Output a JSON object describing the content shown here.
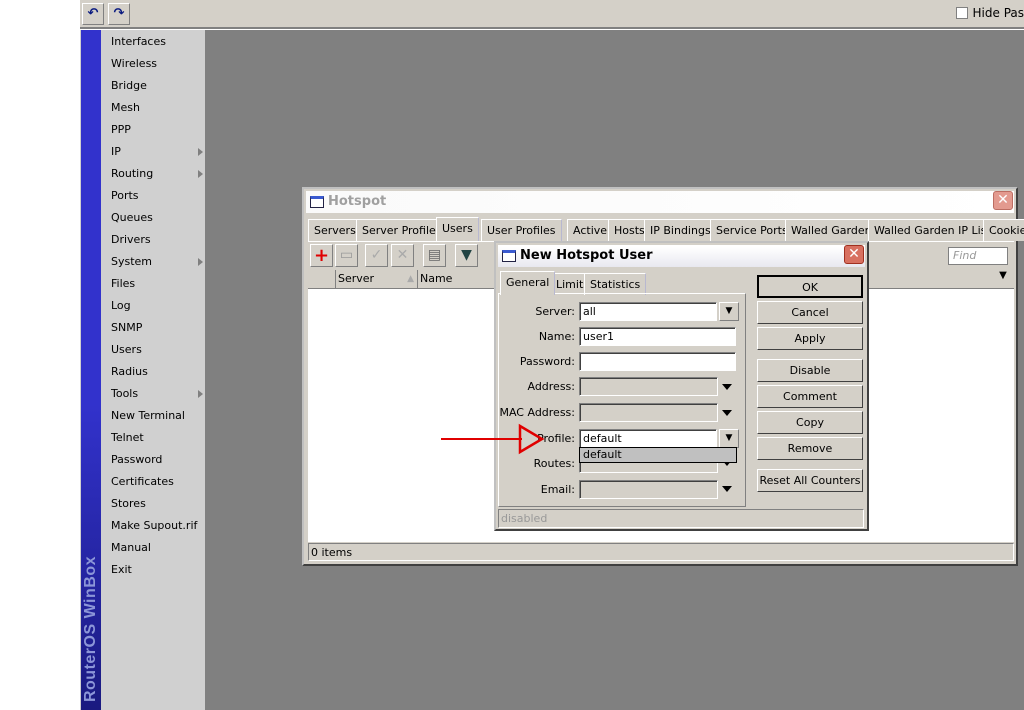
{
  "toolbar": {
    "undo_icon": "undo-icon",
    "redo_icon": "redo-icon",
    "hide_passwords": "Hide Pas"
  },
  "sidebar": {
    "brand": "RouterOS WinBox",
    "items": [
      {
        "label": "Interfaces",
        "sub": false
      },
      {
        "label": "Wireless",
        "sub": false
      },
      {
        "label": "Bridge",
        "sub": false
      },
      {
        "label": "Mesh",
        "sub": false
      },
      {
        "label": "PPP",
        "sub": false
      },
      {
        "label": "IP",
        "sub": true
      },
      {
        "label": "Routing",
        "sub": true
      },
      {
        "label": "Ports",
        "sub": false
      },
      {
        "label": "Queues",
        "sub": false
      },
      {
        "label": "Drivers",
        "sub": false
      },
      {
        "label": "System",
        "sub": true
      },
      {
        "label": "Files",
        "sub": false
      },
      {
        "label": "Log",
        "sub": false
      },
      {
        "label": "SNMP",
        "sub": false
      },
      {
        "label": "Users",
        "sub": false
      },
      {
        "label": "Radius",
        "sub": false
      },
      {
        "label": "Tools",
        "sub": true
      },
      {
        "label": "New Terminal",
        "sub": false
      },
      {
        "label": "Telnet",
        "sub": false
      },
      {
        "label": "Password",
        "sub": false
      },
      {
        "label": "Certificates",
        "sub": false
      },
      {
        "label": "Stores",
        "sub": false
      },
      {
        "label": "Make Supout.rif",
        "sub": false
      },
      {
        "label": "Manual",
        "sub": false
      },
      {
        "label": "Exit",
        "sub": false
      }
    ]
  },
  "hotspot": {
    "title": "Hotspot",
    "tabs": [
      "Servers",
      "Server Profiles",
      "Users",
      "User Profiles",
      "Active",
      "Hosts",
      "IP Bindings",
      "Service Ports",
      "Walled Garden",
      "Walled Garden IP List",
      "Cookies"
    ],
    "active_tab": "Users",
    "find_placeholder": "Find",
    "columns": [
      "Server",
      "Name"
    ],
    "status": "0 items"
  },
  "dialog": {
    "title": "New Hotspot User",
    "tabs": [
      "General",
      "Limits",
      "Statistics"
    ],
    "fields": {
      "server_label": "Server:",
      "server": "all",
      "name_label": "Name:",
      "name": "user1",
      "password_label": "Password:",
      "password": "",
      "address_label": "Address:",
      "mac_label": "MAC Address:",
      "profile_label": "Profile:",
      "profile": "default",
      "routes_label": "Routes:",
      "email_label": "Email:"
    },
    "profile_options": [
      "default"
    ],
    "buttons": [
      "OK",
      "Cancel",
      "Apply",
      "Disable",
      "Comment",
      "Copy",
      "Remove",
      "Reset All Counters"
    ],
    "status": "disabled"
  },
  "annotation_color": "#e00000"
}
